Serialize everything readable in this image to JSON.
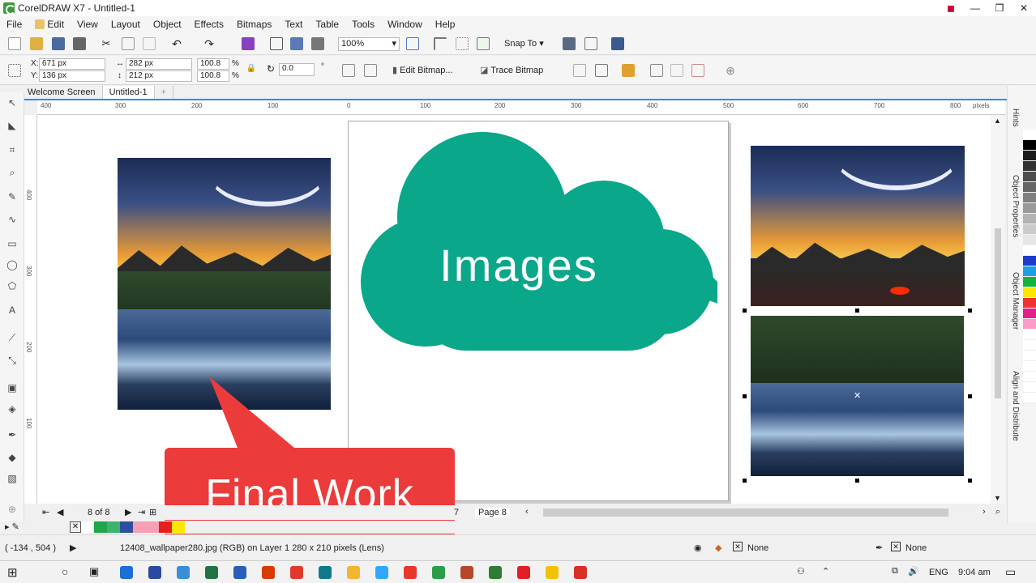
{
  "window": {
    "title": "CorelDRAW X7 - Untitled-1"
  },
  "menu": [
    {
      "label": "File"
    },
    {
      "label": "Edit"
    },
    {
      "label": "View"
    },
    {
      "label": "Layout"
    },
    {
      "label": "Object"
    },
    {
      "label": "Effects"
    },
    {
      "label": "Bitmaps"
    },
    {
      "label": "Text"
    },
    {
      "label": "Table"
    },
    {
      "label": "Tools"
    },
    {
      "label": "Window"
    },
    {
      "label": "Help"
    }
  ],
  "standard_toolbar": {
    "zoom": "100%",
    "snap_to": "Snap To"
  },
  "property_bar": {
    "x_label": "X:",
    "x_value": "671 px",
    "y_label": "Y:",
    "y_value": "136 px",
    "width_value": "282 px",
    "height_value": "212 px",
    "scale_w": "100.8",
    "scale_h": "100.8",
    "percent": "%",
    "rotation": "0.0",
    "degree": "°",
    "edit_bitmap": "Edit Bitmap...",
    "trace_bitmap": "Trace Bitmap"
  },
  "document_tabs": [
    {
      "label": "Welcome Screen"
    },
    {
      "label": "Untitled-1"
    }
  ],
  "ruler": {
    "h_ticks": [
      "400",
      "300",
      "200",
      "100",
      "0",
      "100",
      "200",
      "300",
      "400",
      "500",
      "600",
      "700",
      "800"
    ],
    "units": "pixels",
    "v_ticks": [
      "400",
      "300",
      "200",
      "100"
    ]
  },
  "canvas": {
    "cloud_text": "Images",
    "callout_text": "Final Work",
    "cloud_color": "#0aa78a",
    "callout_color": "#ec3b3b"
  },
  "right_panel": {
    "tabs": [
      "Hints",
      "Object Properties",
      "Object Manager",
      "Align and Distribute"
    ]
  },
  "palette_colors": [
    "#ffffff",
    "#000000",
    "#1a1a1a",
    "#333333",
    "#4d4d4d",
    "#666666",
    "#808080",
    "#999999",
    "#b3b3b3",
    "#cccccc",
    "#e6e6e6",
    "#ffffff",
    "#1e3cc8",
    "#1ea0e6",
    "#12b43c",
    "#ffe600",
    "#f03232",
    "#e61e8c",
    "#ff9bc8",
    "#ffffff",
    "#ffffff",
    "#ffffff",
    "#ffffff",
    "#ffffff",
    "#ffffff",
    "#ffffff"
  ],
  "navigator": {
    "page_count": "8 of 8",
    "page_num": "7",
    "page_label": "Page 8"
  },
  "doc_palette_colors": [
    "#ffffff",
    "#1ea84a",
    "#3cb46e",
    "#2d4fa0",
    "#f5a0b4",
    "#f5a0b4",
    "#e61e1e",
    "#ffe600"
  ],
  "status": {
    "coords": "( -134 , 504 )",
    "info": "12408_wallpaper280.jpg (RGB) on Layer 1 280 x 210 pixels (Lens)",
    "fill": "None",
    "outline": "None"
  },
  "taskbar": {
    "lang": "ENG",
    "time": "9:04 am",
    "apps": [
      "#1e6fd9",
      "#2a4aa0",
      "#3a8dd9",
      "#217346",
      "#2b5eb8",
      "#d83b01",
      "#e03a2f",
      "#0f7b8a",
      "#f2b632",
      "#31a8ff",
      "#e8352e",
      "#2c9e4a",
      "#b7472a",
      "#2f7d32",
      "#e31e24",
      "#f2c200",
      "#d93025"
    ]
  }
}
